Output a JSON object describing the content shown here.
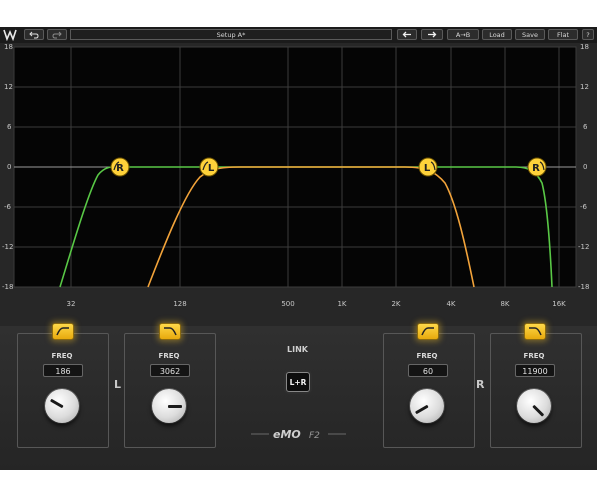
{
  "toolbar": {
    "undo_icon": "undo-icon",
    "redo_icon": "redo-icon",
    "preset_name": "Setup A*",
    "prev_icon": "arrow-left-icon",
    "next_icon": "arrow-right-icon",
    "ab_label": "A→B",
    "load_label": "Load",
    "save_label": "Save",
    "flat_label": "Flat",
    "help_label": "?"
  },
  "graph": {
    "y_ticks": [
      "18",
      "12",
      "6",
      "0",
      "-6",
      "-12",
      "-18"
    ],
    "x_ticks": [
      "32",
      "128",
      "500",
      "1K",
      "2K",
      "4K",
      "8K",
      "16K"
    ],
    "handles": [
      {
        "label": "R",
        "type": "hp"
      },
      {
        "label": "L",
        "type": "hp"
      },
      {
        "label": "L",
        "type": "lp"
      },
      {
        "label": "R",
        "type": "lp"
      }
    ],
    "colors": {
      "left_curve": "#f2a33a",
      "right_curve": "#59c846",
      "handle": "#ffd23a"
    }
  },
  "bands": [
    {
      "channel": "L",
      "filter_type": "high-pass",
      "freq_label": "FREQ",
      "freq_value": "186"
    },
    {
      "channel": "L",
      "filter_type": "low-pass",
      "freq_label": "FREQ",
      "freq_value": "3062"
    },
    {
      "channel": "R",
      "filter_type": "high-pass",
      "freq_label": "FREQ",
      "freq_value": "60"
    },
    {
      "channel": "R",
      "filter_type": "low-pass",
      "freq_label": "FREQ",
      "freq_value": "11900"
    }
  ],
  "channel_labels": {
    "left": "L",
    "right": "R"
  },
  "link": {
    "label": "LINK",
    "button_label": "L+R"
  },
  "brand": {
    "text_main": "eMO",
    "text_sub": "F2"
  }
}
